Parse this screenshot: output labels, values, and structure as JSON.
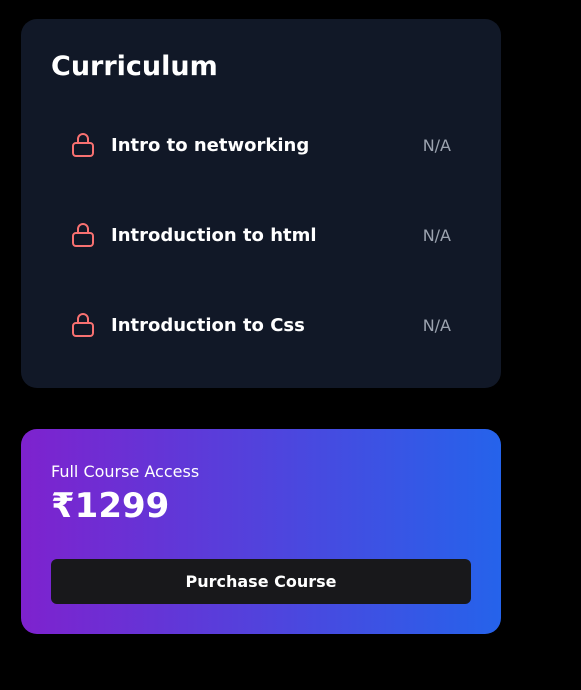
{
  "curriculum": {
    "title": "Curriculum",
    "lessons": [
      {
        "label": "Intro to networking",
        "status": "N/A",
        "icon": "lock-icon"
      },
      {
        "label": "Introduction to html",
        "status": "N/A",
        "icon": "lock-icon"
      },
      {
        "label": "Introduction to Css",
        "status": "N/A",
        "icon": "lock-icon"
      }
    ]
  },
  "purchase": {
    "access_label": "Full Course Access",
    "price": "₹1299",
    "button_label": "Purchase Course"
  },
  "colors": {
    "background": "#000000",
    "card": "#111827",
    "lock_icon": "#f87171",
    "status_text": "#9ca3af",
    "gradient_start": "#7e22ce",
    "gradient_end": "#2563eb",
    "button": "#18181b"
  }
}
